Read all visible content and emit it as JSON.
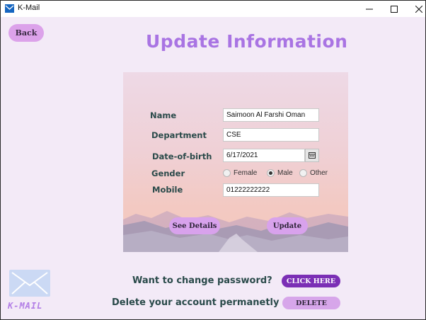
{
  "window": {
    "title": "K-Mail"
  },
  "header": {
    "back_label": "Back",
    "title": "Update Information"
  },
  "form": {
    "name_label": "Name",
    "name_value": "Saimoon Al Farshi Oman",
    "department_label": "Department",
    "department_value": "CSE",
    "dob_label": "Date-of-birth",
    "dob_value": "6/17/2021",
    "gender_label": "Gender",
    "gender_options": [
      "Female",
      "Male",
      "Other"
    ],
    "gender_selected": "Male",
    "mobile_label": "Mobile",
    "mobile_value": "01222222222",
    "see_details_label": "See Details",
    "update_label": "Update"
  },
  "footer": {
    "logo_text": "K-MAIL",
    "password_prompt": "Want to change password?",
    "click_here_label": "CLICK HERE",
    "delete_prompt": "Delete your account permanetly",
    "delete_label": "DELETE"
  },
  "colors": {
    "background": "#f3eaf7",
    "title": "#a974e3",
    "pill": "#d8a2ec",
    "click_here": "#7b2fb5",
    "label_text": "#2a4a4a"
  },
  "icons": [
    "app-mail-icon",
    "minimize-icon",
    "maximize-icon",
    "close-icon",
    "calendar-icon",
    "envelope-logo-icon"
  ]
}
